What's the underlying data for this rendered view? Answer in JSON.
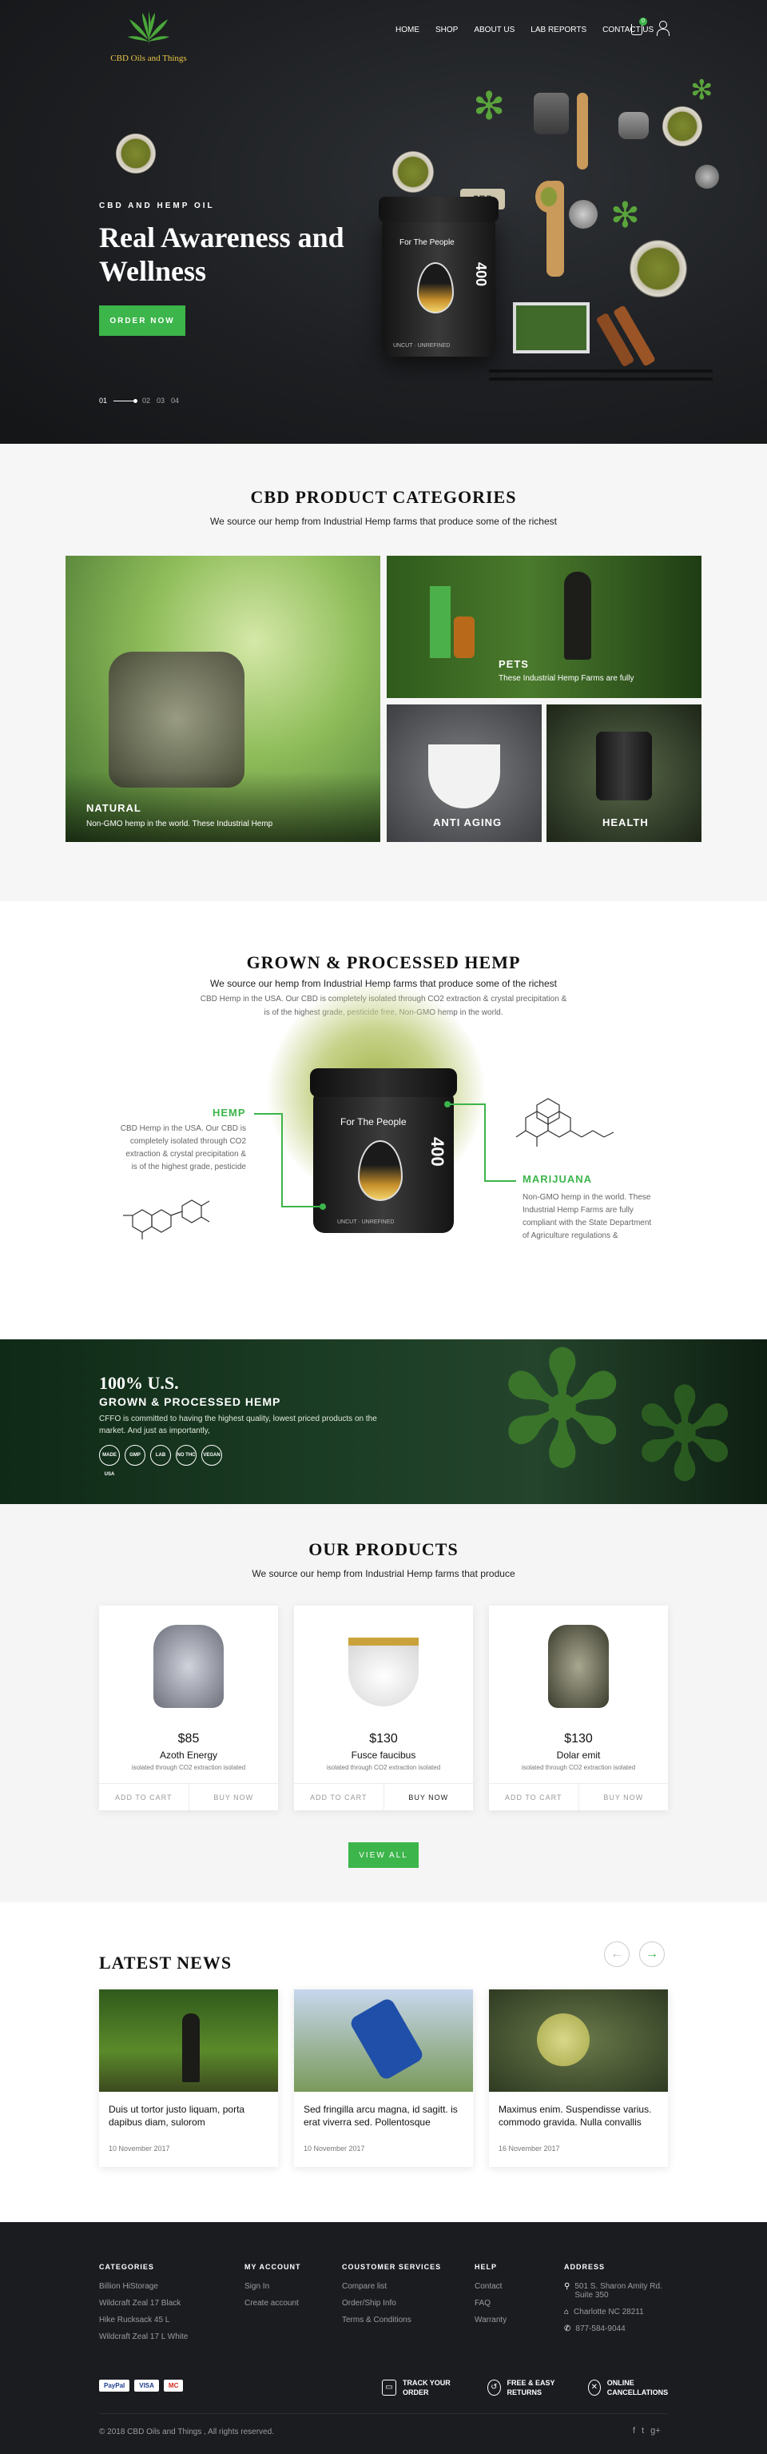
{
  "logo": {
    "text": "CBD Oils and Things"
  },
  "nav": {
    "items": [
      "HOME",
      "SHOP",
      "ABOUT US",
      "LAB REPORTS",
      "CONTACT US"
    ],
    "cart_count": "0"
  },
  "hero": {
    "eyebrow": "CBD AND HEMP OIL",
    "title": "Real Awareness and Wellness",
    "button": "ORDER NOW",
    "slides": [
      "01",
      "02",
      "03",
      "04"
    ],
    "jar_label": "For The People",
    "jar_number": "400",
    "jar_bottom": "UNCUT · UNREFINED",
    "tag_text": "CBD"
  },
  "categories": {
    "title": "CBD PRODUCT CATEGORIES",
    "subtitle": "We source our hemp from Industrial Hemp farms that produce some of the richest",
    "items": [
      {
        "label": "NATURAL",
        "desc": "Non-GMO hemp in the world. These Industrial Hemp"
      },
      {
        "label": "PETS",
        "desc": "These Industrial Hemp Farms are fully"
      },
      {
        "label": "ANTI AGING",
        "desc": ""
      },
      {
        "label": "HEALTH",
        "desc": ""
      }
    ]
  },
  "grown": {
    "title": "GROWN & PROCESSED HEMP",
    "subtitle": "We source our hemp from Industrial Hemp farms that produce some of the richest",
    "desc": "CBD Hemp in the USA. Our CBD is completely isolated through CO2 extraction & crystal precipitation & is of the highest grade, pesticide free, Non-GMO hemp in the world.",
    "left_label": "HEMP",
    "left_text": "CBD Hemp in the USA. Our CBD is completely isolated through CO2 extraction & crystal precipitation & is of the highest grade, pesticide",
    "right_label": "MARIJUANA",
    "right_text": "Non-GMO hemp in the world. These Industrial Hemp Farms are fully compliant with the State Department of Agriculture regulations &",
    "jar_label": "For The People",
    "jar_number": "400",
    "jar_bottom": "UNCUT · UNREFINED"
  },
  "banner": {
    "title": "100% U.S.",
    "subtitle": "GROWN & PROCESSED HEMP",
    "desc": "CFFO is committed to having the highest quality, lowest priced products on the market. And just as importantly,",
    "badges": [
      "MADE USA",
      "GMP",
      "LAB",
      "NO THC",
      "VEGAN"
    ]
  },
  "products": {
    "title": "OUR PRODUCTS",
    "subtitle": "We source our hemp from Industrial Hemp farms that produce",
    "items": [
      {
        "price": "$85",
        "name": "Azoth Energy",
        "desc": "isolated through CO2 extraction isolated"
      },
      {
        "price": "$130",
        "name": "Fusce faucibus",
        "desc": "isolated through CO2 extraction isolated"
      },
      {
        "price": "$130",
        "name": "Dolar emit",
        "desc": "isolated through CO2 extraction isolated"
      }
    ],
    "add_to_cart": "ADD TO CART",
    "buy_now": "BUY NOW",
    "view_all": "VIEW ALL"
  },
  "news": {
    "title": "LATEST NEWS",
    "items": [
      {
        "title": "Duis ut tortor justo liquam, porta dapibus diam, sulorom",
        "date": "10 November 2017"
      },
      {
        "title": "Sed fringilla arcu magna, id sagitt. is erat viverra sed. Pollentosque",
        "date": "10 November 2017"
      },
      {
        "title": "Maximus enim. Suspendisse varius. commodo gravida. Nulla convallis",
        "date": "16 November 2017"
      }
    ]
  },
  "footer": {
    "categories": {
      "title": "CATEGORIES",
      "links": [
        "Billion HiStorage",
        "Wildcraft Zeal 17 Black",
        "Hike Rucksack 45 L",
        "Wildcraft Zeal 17 L White"
      ]
    },
    "account": {
      "title": "MY ACCOUNT",
      "links": [
        "Sign In",
        "Create account"
      ]
    },
    "service": {
      "title": "COUSTOMER SERVICES",
      "links": [
        "Compare list",
        "Order/Ship Info",
        "Terms & Conditions"
      ]
    },
    "help": {
      "title": "HELP",
      "links": [
        "Contact",
        "FAQ",
        "Warranty"
      ]
    },
    "address": {
      "title": "ADDRESS",
      "street": "501 S. Sharon Amity Rd. Suite 350",
      "city": "Charlotte NC 28211",
      "phone": "877-584-9044"
    },
    "payments": [
      "PayPal",
      "VISA",
      "MC"
    ],
    "features": [
      {
        "icon": "truck-icon",
        "text": "TRACK YOUR ORDER"
      },
      {
        "icon": "return-icon",
        "text": "FREE & EASY RETURNS"
      },
      {
        "icon": "cancel-icon",
        "text": "ONLINE CANCELLATIONS"
      }
    ],
    "copyright": "© 2018 CBD Oils and Things , All rights reserved.",
    "social": [
      "f",
      "t",
      "g+"
    ]
  },
  "colors": {
    "accent": "#3cb54a",
    "dark": "#1a1c20",
    "gold": "#e8c54a"
  }
}
